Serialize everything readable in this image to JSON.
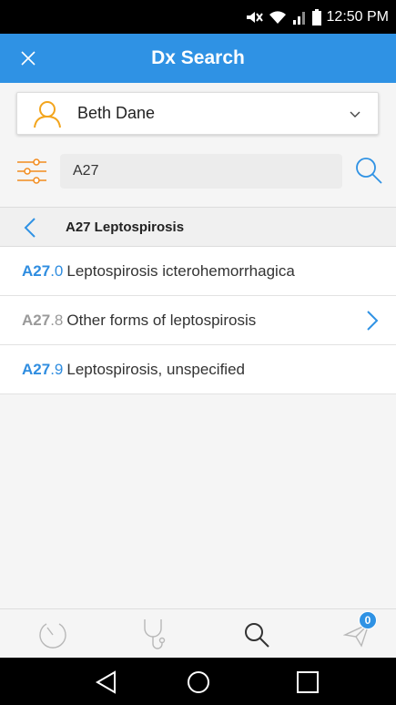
{
  "status_bar": {
    "time": "12:50 PM",
    "icons": [
      "mute-icon",
      "wifi-icon",
      "signal-icon",
      "battery-icon"
    ]
  },
  "app_bar": {
    "title": "Dx Search",
    "close_icon": "close-icon"
  },
  "patient_selector": {
    "name": "Beth Dane",
    "avatar_icon": "person-icon",
    "dropdown_icon": "chevron-down-icon"
  },
  "search": {
    "value": "A27",
    "filter_icon": "filter-sliders-icon",
    "search_icon": "search-icon"
  },
  "breadcrumb": {
    "label": "A27 Leptospirosis",
    "back_icon": "chevron-left-icon"
  },
  "results": [
    {
      "code_main": "A27",
      "code_sub": ".0",
      "description": "Leptospirosis icterohemorrhagica",
      "has_children": false
    },
    {
      "code_main": "A27",
      "code_sub": ".8",
      "description": "Other forms of leptospirosis",
      "has_children": true
    },
    {
      "code_main": "A27",
      "code_sub": ".9",
      "description": "Leptospirosis, unspecified",
      "has_children": false
    }
  ],
  "bottom_nav": {
    "items": [
      {
        "name": "history",
        "icon": "clock-icon"
      },
      {
        "name": "stethoscope",
        "icon": "stethoscope-icon"
      },
      {
        "name": "search",
        "icon": "search-icon"
      },
      {
        "name": "send",
        "icon": "send-icon",
        "badge": "0"
      }
    ]
  },
  "colors": {
    "accent": "#2f92e4",
    "avatar": "#f3a51d",
    "filter": "#f28c1e",
    "parent_code": "#9a9a9a"
  }
}
